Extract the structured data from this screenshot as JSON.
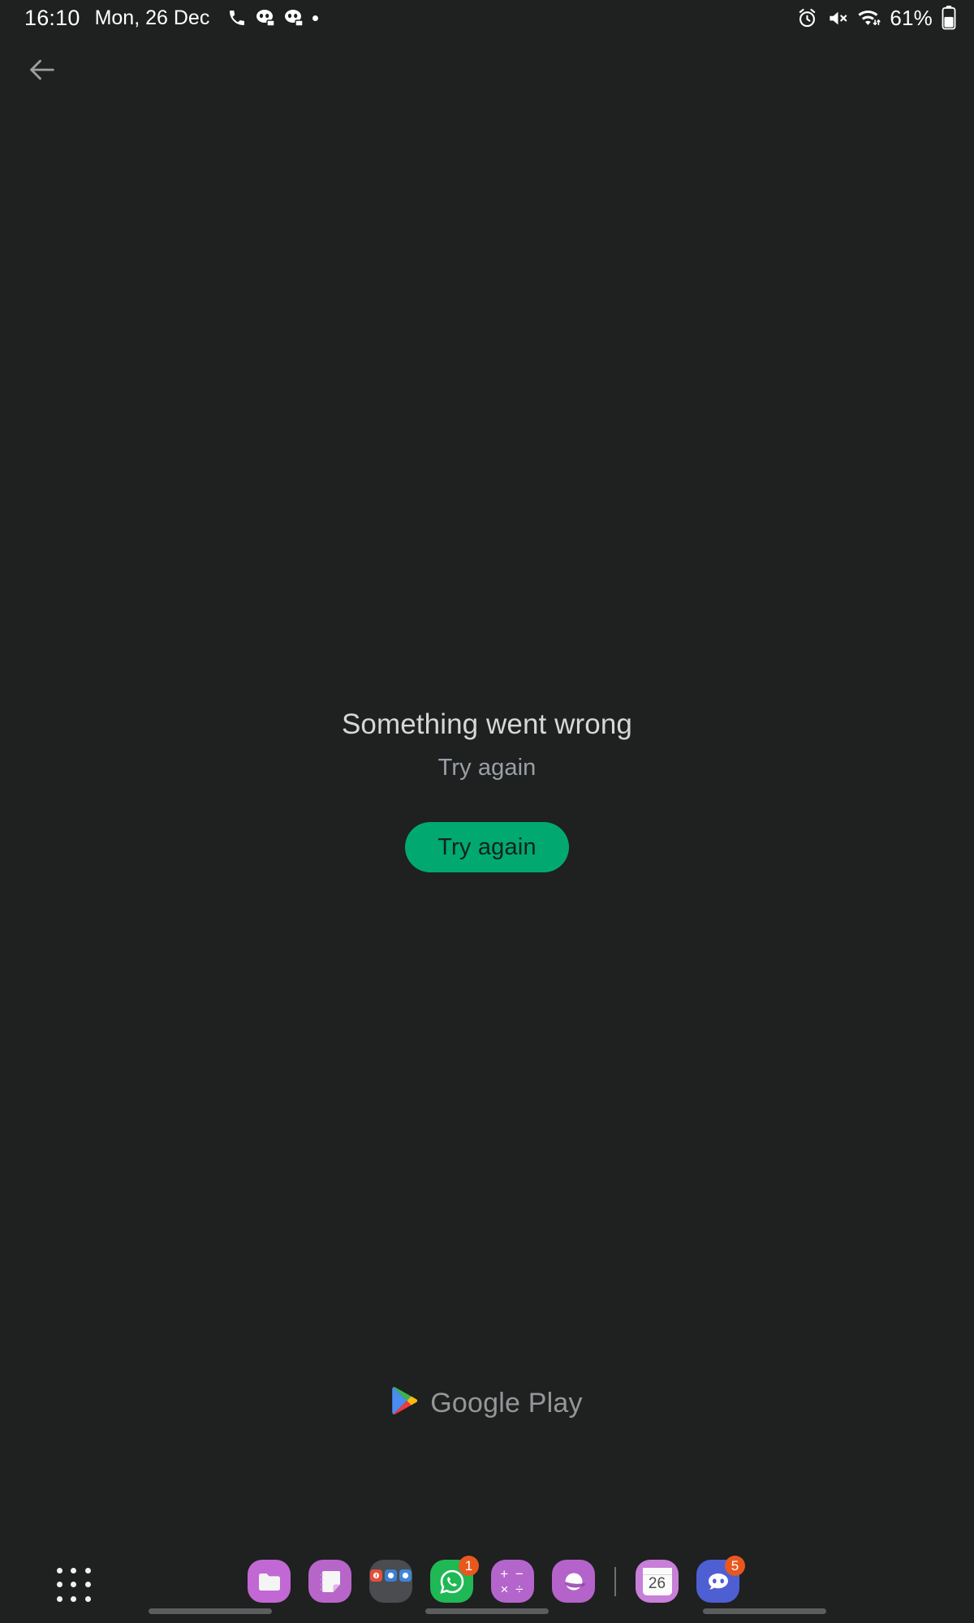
{
  "status_bar": {
    "clock": "16:10",
    "date": "Mon, 26 Dec",
    "left_icons": [
      "phone-icon",
      "discord-notification-icon",
      "discord-notification-icon",
      "dot-indicator"
    ],
    "right_icons": [
      "alarm-icon",
      "volume-muted-icon",
      "wifi-icon"
    ],
    "battery_percent": "61%",
    "battery_icon": "battery-icon"
  },
  "navigation": {
    "back_icon": "back-arrow-icon"
  },
  "main": {
    "error_title": "Something went wrong",
    "error_subtitle": "Try again",
    "retry_button_label": "Try again",
    "retry_button_color": "#01a971"
  },
  "brand": {
    "logo_icon": "google-play-logo-icon",
    "name": "Google Play"
  },
  "taskbar": {
    "app_drawer_icon": "app-drawer-grid-icon",
    "items": [
      {
        "name": "files-app",
        "icon": "folder-icon",
        "badge": ""
      },
      {
        "name": "notes-app",
        "icon": "notes-icon",
        "badge": ""
      },
      {
        "name": "app-folder",
        "icon": "folder-group-icon",
        "badge": ""
      },
      {
        "name": "whatsapp",
        "icon": "whatsapp-icon",
        "badge": "1"
      },
      {
        "name": "calculator",
        "icon": "calculator-icon",
        "badge": ""
      },
      {
        "name": "browser",
        "icon": "browser-icon",
        "badge": ""
      },
      {
        "name": "calendar",
        "icon": "calendar-icon",
        "badge": "",
        "day": "26"
      },
      {
        "name": "discord",
        "icon": "discord-icon",
        "badge": "5"
      }
    ],
    "calculator_glyphs_top": "+ −",
    "calculator_glyphs_bottom": "× ÷"
  }
}
